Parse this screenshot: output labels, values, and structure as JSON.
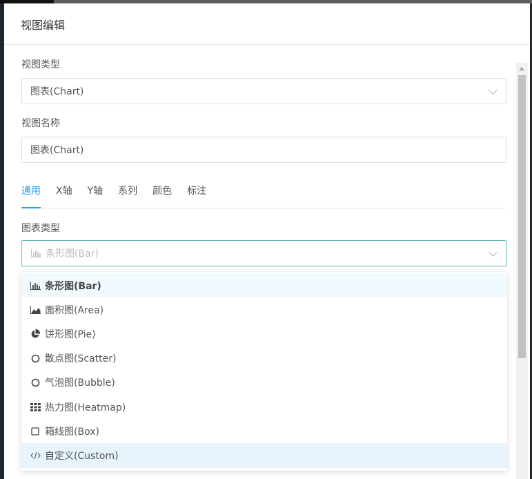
{
  "modal": {
    "title": "视图编辑"
  },
  "view_type": {
    "label": "视图类型",
    "value": "图表(Chart)"
  },
  "view_name": {
    "label": "视图名称",
    "value": "图表(Chart)"
  },
  "tabs": [
    {
      "label": "通用",
      "active": true
    },
    {
      "label": "X轴"
    },
    {
      "label": "Y轴"
    },
    {
      "label": "系列"
    },
    {
      "label": "颜色"
    },
    {
      "label": "标注"
    }
  ],
  "chart_type": {
    "label": "图表类型",
    "placeholder": "条形图(Bar)",
    "options": [
      {
        "label": "条形图(Bar)",
        "icon": "bar-chart-icon",
        "selected": true
      },
      {
        "label": "面积图(Area)",
        "icon": "area-chart-icon"
      },
      {
        "label": "饼形图(Pie)",
        "icon": "pie-chart-icon"
      },
      {
        "label": "散点图(Scatter)",
        "icon": "circle-icon"
      },
      {
        "label": "气泡图(Bubble)",
        "icon": "circle-icon"
      },
      {
        "label": "热力图(Heatmap)",
        "icon": "grid-icon"
      },
      {
        "label": "箱线图(Box)",
        "icon": "square-icon"
      },
      {
        "label": "自定义(Custom)",
        "icon": "code-icon",
        "hovered": true
      }
    ]
  },
  "colors": {
    "accent": "#1e9fff",
    "focus_border": "#5fb8b8"
  }
}
